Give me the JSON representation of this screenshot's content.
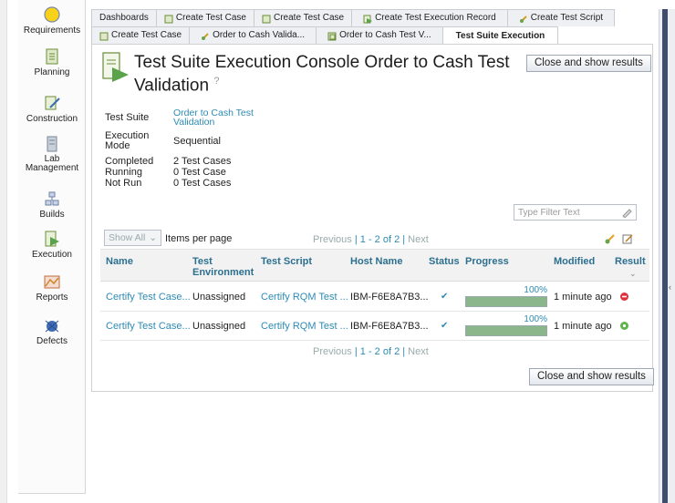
{
  "nav": {
    "items": [
      {
        "label": "Requirements",
        "icon": "requirements-icon"
      },
      {
        "label": "Planning",
        "icon": "planning-icon"
      },
      {
        "label": "Construction",
        "icon": "construction-icon"
      },
      {
        "label": "Lab Management",
        "icon": "lab-management-icon"
      },
      {
        "label": "Builds",
        "icon": "builds-icon"
      },
      {
        "label": "Execution",
        "icon": "execution-icon"
      },
      {
        "label": "Reports",
        "icon": "reports-icon"
      },
      {
        "label": "Defects",
        "icon": "defects-icon"
      }
    ]
  },
  "tabs": {
    "row1": [
      "Dashboards",
      "Create Test Case",
      "Create Test Case",
      "Create Test Execution Record",
      "Create Test Script"
    ],
    "row2": [
      "Create Test Case",
      "Order to Cash Valida...",
      "Order to Cash Test V...",
      "Test Suite Execution"
    ]
  },
  "page": {
    "title": "Test Suite Execution Console Order to Cash Test Validation",
    "help_icon": "?",
    "close_button": "Close and show results"
  },
  "properties": {
    "test_suite_label": "Test Suite",
    "test_suite_value": "Order to Cash Test Validation",
    "execution_mode_label": "Execution Mode",
    "execution_mode_value": "Sequential",
    "completed_label": "Completed",
    "completed_value": "2 Test Cases",
    "running_label": "Running",
    "running_value": "0 Test Case",
    "not_run_label": "Not Run",
    "not_run_value": "0 Test Cases"
  },
  "filter": {
    "placeholder": "Type Filter Text"
  },
  "pager": {
    "show_all": "Show All",
    "items_per_page": "Items per page",
    "previous": "Previous",
    "range": "| 1 - 2 of 2 |",
    "next": "Next"
  },
  "table": {
    "columns": [
      "Name",
      "Test Environment",
      "Test Script",
      "Host Name",
      "Status",
      "Progress",
      "Modified",
      "Result"
    ],
    "rows": [
      {
        "name": "Certify Test Case...",
        "environment": "Unassigned",
        "script": "Certify RQM Test ...",
        "host": "IBM-F6E8A7B3...",
        "status": "✔",
        "progress_pct": 100,
        "progress_label": "100%",
        "modified": "1 minute ago",
        "result": "failed",
        "result_color": "#e0303c"
      },
      {
        "name": "Certify Test Case...",
        "environment": "Unassigned",
        "script": "Certify RQM Test ...",
        "host": "IBM-F6E8A7B3...",
        "status": "✔",
        "progress_pct": 100,
        "progress_label": "100%",
        "modified": "1 minute ago",
        "result": "passed",
        "result_color": "#5fb54a"
      }
    ]
  },
  "colors": {
    "link": "#2d8bb3",
    "progress_fill": "#8bb58a"
  }
}
